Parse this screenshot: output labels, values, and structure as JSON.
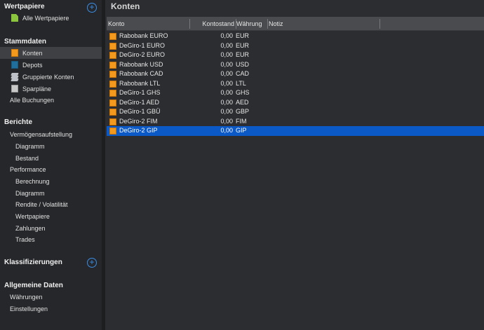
{
  "sidebar": {
    "sections": {
      "wertpapiere": {
        "title": "Wertpapiere",
        "items": [
          "Alle Wertpapiere"
        ]
      },
      "stammdaten": {
        "title": "Stammdaten",
        "items": [
          "Konten",
          "Depots",
          "Gruppierte Konten",
          "Sparpläne",
          "Alle Buchungen"
        ]
      },
      "berichte": {
        "title": "Berichte",
        "items": [
          "Vermögensaufstellung",
          "Diagramm",
          "Bestand",
          "Performance",
          "Berechnung",
          "Diagramm",
          "Rendite / Volatilität",
          "Wertpapiere",
          "Zahlungen",
          "Trades"
        ]
      },
      "klassifizierungen": {
        "title": "Klassifizierungen"
      },
      "allgemeine": {
        "title": "Allgemeine Daten",
        "items": [
          "Währungen",
          "Einstellungen"
        ]
      }
    },
    "add_symbol": "+"
  },
  "main": {
    "title": "Konten",
    "columns": [
      "Konto",
      "Kontostand",
      "Währung",
      "Notiz"
    ],
    "rows": [
      {
        "name": "Rabobank EURO",
        "balance": "0,00",
        "currency": "EUR",
        "note": ""
      },
      {
        "name": "DeGiro-1 EURO",
        "balance": "0,00",
        "currency": "EUR",
        "note": ""
      },
      {
        "name": "DeGiro-2 EURO",
        "balance": "0,00",
        "currency": "EUR",
        "note": ""
      },
      {
        "name": "Rabobank USD",
        "balance": "0,00",
        "currency": "USD",
        "note": ""
      },
      {
        "name": "Rabobank CAD",
        "balance": "0,00",
        "currency": "CAD",
        "note": ""
      },
      {
        "name": "Rabobank LTL",
        "balance": "0,00",
        "currency": "LTL",
        "note": ""
      },
      {
        "name": "DeGiro-1 GHS",
        "balance": "0,00",
        "currency": "GHS",
        "note": ""
      },
      {
        "name": "DeGiro-1 AED",
        "balance": "0,00",
        "currency": "AED",
        "note": ""
      },
      {
        "name": "DeGiro-1 GBÜ",
        "balance": "0,00",
        "currency": "GBP",
        "note": ""
      },
      {
        "name": "DeGiro-2 FIM",
        "balance": "0,00",
        "currency": "FIM",
        "note": ""
      },
      {
        "name": "DeGiro-2 GIP",
        "balance": "0,00",
        "currency": "GIP",
        "note": ""
      }
    ],
    "selected_row": "DeGiro-2 GIP"
  },
  "colors": {
    "accent": "#3a8ee6",
    "selection": "#0b58c7",
    "account_icon": "#f39a1e"
  }
}
